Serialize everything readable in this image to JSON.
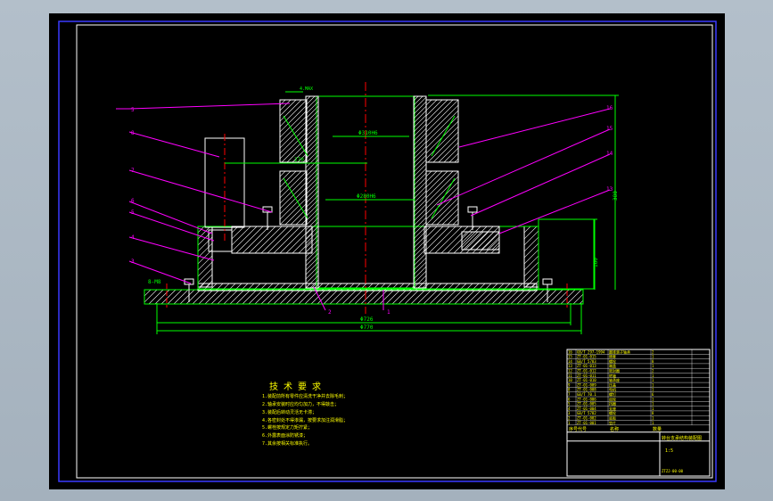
{
  "colors": {
    "background": "#000000",
    "frame": "#3a3aff",
    "outline": "#00ff00",
    "leader": "#ff00ff",
    "hatch": "#ffffff",
    "centerline": "#ff0000",
    "text": "#ffff00",
    "dimension": "#00ff00"
  },
  "drawing": {
    "callouts": [
      "5",
      "8",
      "7",
      "6",
      "5",
      "4",
      "3",
      "2",
      "1",
      "16",
      "15",
      "14",
      "13"
    ],
    "dimensions": {
      "d_top_bearing": "Φ310H6",
      "d_bottom_bearing": "Φ280H6",
      "d_inner": "Φ726",
      "d_outer": "Φ770",
      "h_total": "380",
      "h_lower": "160",
      "offset": "270",
      "bolt_spec": "8-M8",
      "small_note": "4.MAX"
    }
  },
  "tech_requirements": {
    "title": "技 术 要 求",
    "items": [
      "1.装配前所有零件应清洗干净并去除毛刺；",
      "2.轴承安装时应均匀加力，不得敲击；",
      "3.装配后转动灵活无卡滞；",
      "4.各密封处不得渗漏，按要求加注润滑脂；",
      "5.螺栓按规定力矩拧紧；",
      "6.外露表面涂防锈漆；",
      "7.其余按相关标准执行。"
    ]
  },
  "title_block": {
    "part_name": "转台支承结构装配图",
    "scale": "1:5",
    "drawing_no": "ZTZJ-00-00",
    "rows": [
      [
        "16",
        "GB/T 297-1994",
        "圆锥滚子轴承",
        "2"
      ],
      [
        "15",
        "ZT-01-015",
        "隔套",
        "1"
      ],
      [
        "14",
        "GB/T 5783",
        "螺栓",
        "8"
      ],
      [
        "13",
        "ZT-01-013",
        "端盖",
        "1"
      ],
      [
        "12",
        "ZT-01-012",
        "密封圈",
        "2"
      ],
      [
        "11",
        "ZT-01-011",
        "转轴",
        "1"
      ],
      [
        "10",
        "ZT-01-010",
        "轴承座",
        "1"
      ],
      [
        "9",
        "ZT-01-009",
        "压盖",
        "1"
      ],
      [
        "8",
        "ZT-01-008",
        "电机",
        "1"
      ],
      [
        "7",
        "GB/T 70.1",
        "螺钉",
        "6"
      ],
      [
        "6",
        "ZT-01-006",
        "齿轮",
        "1"
      ],
      [
        "5",
        "ZT-01-005",
        "挡圈",
        "1"
      ],
      [
        "4",
        "ZT-01-004",
        "支座",
        "1"
      ],
      [
        "3",
        "GB/T 5782",
        "螺栓",
        "8"
      ],
      [
        "2",
        "ZT-01-002",
        "底板",
        "1"
      ],
      [
        "1",
        "ZT-01-001",
        "垫片",
        "1"
      ]
    ],
    "header": [
      "序号",
      "代号",
      "名称",
      "数量"
    ]
  }
}
